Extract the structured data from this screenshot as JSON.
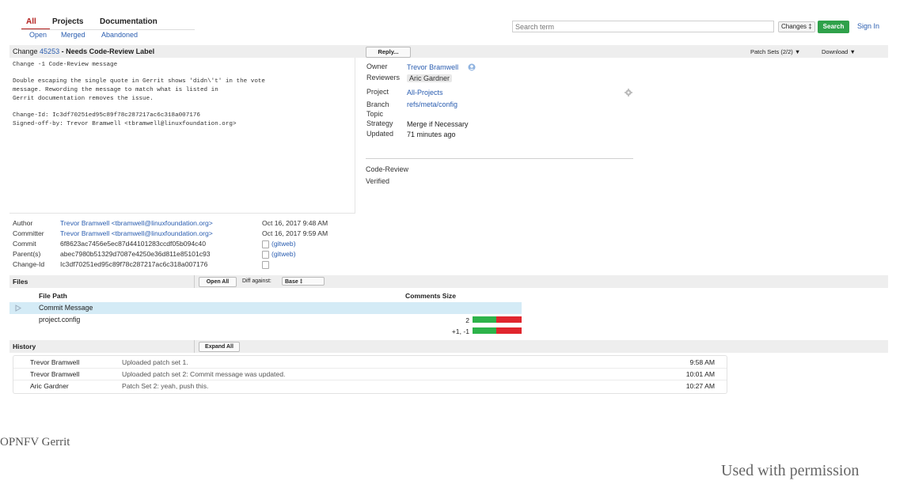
{
  "nav": {
    "tabs": [
      "All",
      "Projects",
      "Documentation"
    ],
    "subtabs": [
      "Open",
      "Merged",
      "Abandoned"
    ]
  },
  "search": {
    "placeholder": "Search term",
    "scope": "Changes ‡",
    "button": "Search",
    "signin": "Sign In"
  },
  "change": {
    "prefix": "Change",
    "number": "45253",
    "status": "- Needs Code-Review Label",
    "reply": "Reply...",
    "patch_sets": "Patch Sets (2/2) ▼",
    "download": "Download ▼"
  },
  "commit_message": [
    "Change -1 Code-Review message",
    "Double escaping the single quote in Gerrit shows 'didn\\'t' in the vote",
    "message. Rewording the message to match what is listed in",
    "Gerrit documentation removes the issue.",
    "Change-Id: Ic3df70251ed95c89f78c287217ac6c318a007176",
    "Signed-off-by: Trevor Bramwell <tbramwell@linuxfoundation.org>"
  ],
  "info": {
    "owner_label": "Owner",
    "owner": "Trevor Bramwell",
    "reviewers_label": "Reviewers",
    "reviewer": "Aric Gardner",
    "project_label": "Project",
    "project": "All-Projects",
    "branch_label": "Branch",
    "branch": "refs/meta/config",
    "topic_label": "Topic",
    "strategy_label": "Strategy",
    "strategy": "Merge if Necessary",
    "updated_label": "Updated",
    "updated": "71 minutes ago",
    "labels": [
      "Code-Review",
      "Verified"
    ]
  },
  "commit_meta": {
    "author_label": "Author",
    "author": "Trevor Bramwell <tbramwell@linuxfoundation.org>",
    "author_date": "Oct 16, 2017 9:48 AM",
    "committer_label": "Committer",
    "committer": "Trevor Bramwell <tbramwell@linuxfoundation.org>",
    "committer_date": "Oct 16, 2017 9:59 AM",
    "commit_label": "Commit",
    "commit": "6f8623ac7456e5ec87d44101283ccdf05b094c40",
    "commit_link": "(gitweb)",
    "parent_label": "Parent(s)",
    "parent": "abec7980b51329d7087e4250e36d811e85101c93",
    "parent_link": "(gitweb)",
    "changeid_label": "Change-Id",
    "changeid": "Ic3df70251ed95c89f78c287217ac6c318a007176"
  },
  "files": {
    "title": "Files",
    "open_all": "Open All",
    "diff_label": "Diff against:",
    "diff_value": "Base      ‡",
    "col_path": "File Path",
    "col_comments_size": "Comments Size",
    "rows": [
      {
        "path": "Commit Message",
        "size": ""
      },
      {
        "path": "project.config",
        "size": "2"
      }
    ],
    "total": "+1, -1"
  },
  "history": {
    "title": "History",
    "expand_all": "Expand All",
    "rows": [
      {
        "who": "Trevor Bramwell",
        "msg": "Uploaded patch set 1.",
        "time": "9:58 AM"
      },
      {
        "who": "Trevor Bramwell",
        "msg": "Uploaded patch set 2: Commit message was updated.",
        "time": "10:01 AM"
      },
      {
        "who": "Aric Gardner",
        "msg": "Patch Set 2: yeah, push this.",
        "time": "10:27 AM"
      }
    ]
  },
  "caption": "OPNFV Gerrit",
  "credit": "Used with permission"
}
